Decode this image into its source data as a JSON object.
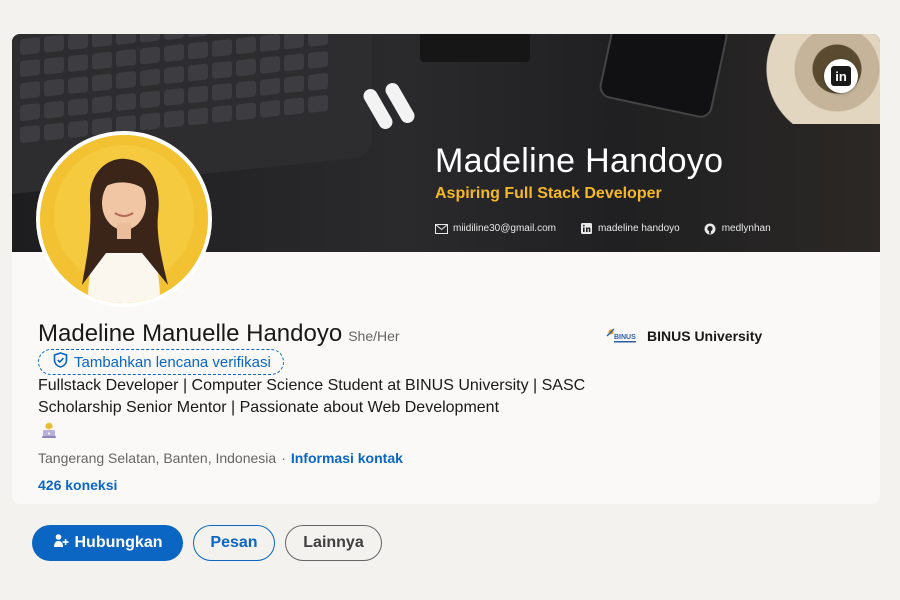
{
  "banner": {
    "name": "Madeline Handoyo",
    "role": "Aspiring Full Stack Developer",
    "contacts": [
      {
        "icon": "mail-icon",
        "text": "miidiline30@gmail.com"
      },
      {
        "icon": "linkedin-icon",
        "text": "madeline handoyo"
      },
      {
        "icon": "github-icon",
        "text": "medlynhan"
      }
    ]
  },
  "profile": {
    "name": "Madeline Manuelle Handoyo",
    "pronouns": "She/Her",
    "verify_label": "Tambahkan lencana verifikasi",
    "headline": "Fullstack Developer | Computer Science Student at BINUS University | SASC Scholarship Senior Mentor | Passionate about Web Development",
    "location": "Tangerang Selatan, Banten, Indonesia",
    "separator": "·",
    "contact_info_label": "Informasi kontak",
    "connections": "426 koneksi"
  },
  "education": {
    "name": "BINUS University",
    "logo_text": "BINUS"
  },
  "actions": {
    "connect": "Hubungkan",
    "message": "Pesan",
    "more": "Lainnya"
  },
  "colors": {
    "accent": "#0a66c2",
    "banner_role": "#f5b829",
    "background": "#f4f2ee"
  }
}
